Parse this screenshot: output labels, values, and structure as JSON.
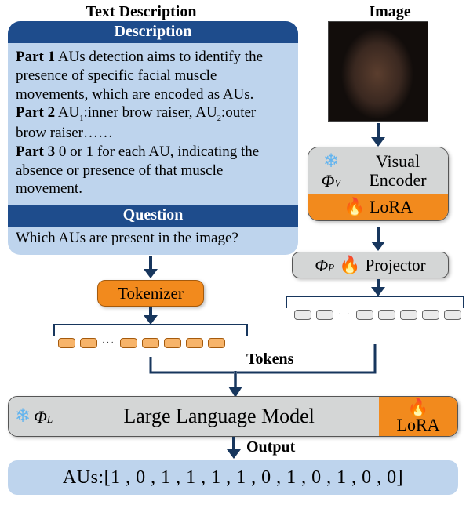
{
  "headers": {
    "text_description": "Text Description",
    "image": "Image"
  },
  "description": {
    "title": "Description",
    "part1_label": "Part 1",
    "part1_text": " AUs detection aims to identify the presence of specific facial muscle movements, which are encoded as AUs.",
    "part2_label": "Part 2",
    "part2_text_a": " AU",
    "part2_sub1": "1",
    "part2_text_b": ":inner brow raiser, AU",
    "part2_sub2": "2",
    "part2_text_c": ":outer brow raiser……",
    "part3_label": "Part 3",
    "part3_text": " 0 or 1 for each AU, indicating the absence or presence of that muscle movement."
  },
  "question": {
    "title": "Question",
    "text": "Which AUs are present in the image?"
  },
  "blocks": {
    "visual_encoder": "Visual\nEncoder",
    "visual_encoder_line1": "Visual",
    "visual_encoder_line2": "Encoder",
    "lora": "LoRA",
    "projector": "Projector",
    "tokenizer": "Tokenizer",
    "llm": "Large Language Model",
    "tokens_label": "Tokens",
    "output_label": "Output"
  },
  "symbols": {
    "phi_v": "Φ",
    "phi_v_sub": "V",
    "phi_p": "Φ",
    "phi_p_sub": "P",
    "phi_l": "Φ",
    "phi_l_sub": "L"
  },
  "output": {
    "text": "AUs:[1 , 0 , 1 , 1 , 1 , 1 , 0 , 1 , 0 , 1 , 0 , 0]"
  },
  "icons": {
    "frozen": "frozen",
    "trainable": "trainable"
  }
}
